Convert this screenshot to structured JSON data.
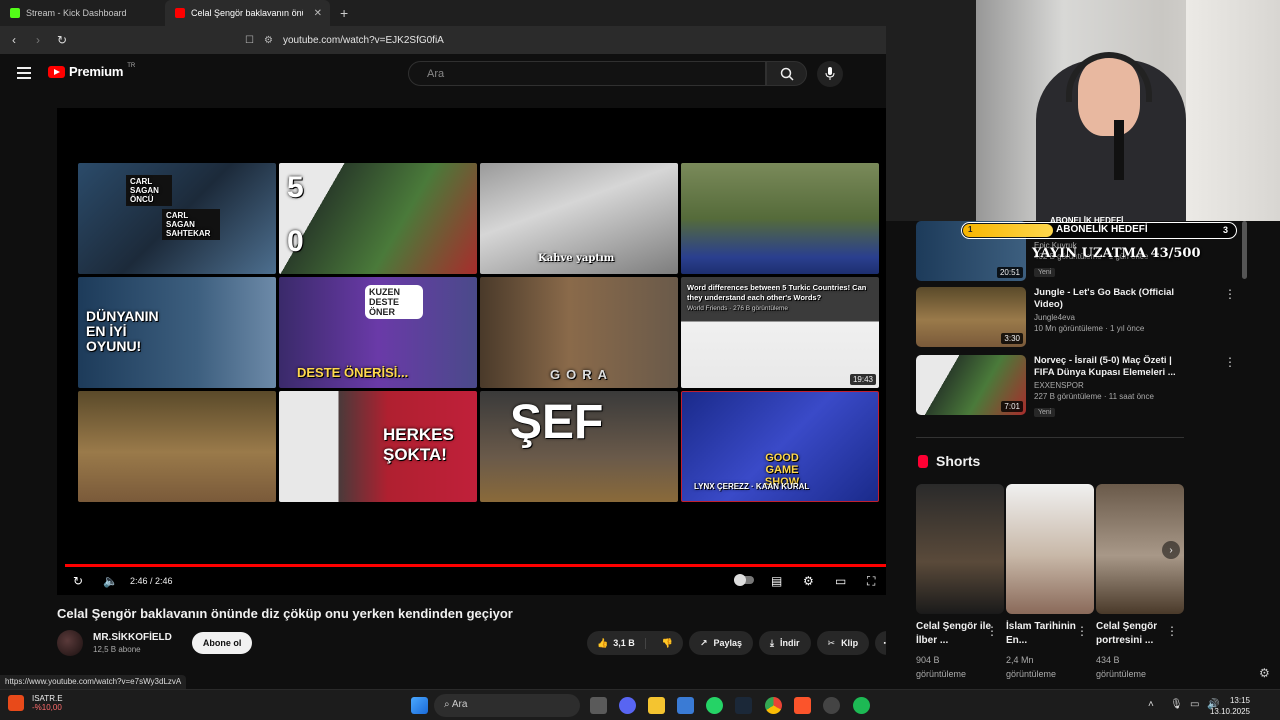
{
  "browser": {
    "tabs": [
      {
        "label": "Stream - Kick Dashboard",
        "active": false
      },
      {
        "label": "Celal Şengör baklavanın önünde",
        "active": true
      }
    ],
    "url": "youtube.com/watch?v=EJK2SfG0fiA",
    "status_url": "https://www.youtube.com/watch?v=e7sWy3dLzvA"
  },
  "youtube": {
    "logo_text": "Premium",
    "logo_sup": "TR",
    "search_placeholder": "Ara"
  },
  "player": {
    "time": "2:46 / 2:46",
    "progress_fraction": 1.0,
    "endscreen": [
      {
        "caption_a": "CARL SAGAN ÖNCÜ",
        "caption_b": "CARL SAGAN SAHTEKAR",
        "duration": ""
      },
      {
        "caption_a": "5",
        "caption_b": "0",
        "duration": ""
      },
      {
        "caption_a": "Kahve yaptım",
        "caption_b": "",
        "duration": ""
      },
      {
        "caption_a": "",
        "caption_b": "",
        "duration": ""
      },
      {
        "caption_a": "DÜNYANIN EN İYİ OYUNU!",
        "caption_b": "",
        "duration": ""
      },
      {
        "caption_a": "KUZEN DESTE ÖNER",
        "caption_b": "DESTE ÖNERİSİ...",
        "duration": ""
      },
      {
        "caption_a": "GORA",
        "caption_b": "",
        "duration": ""
      },
      {
        "caption_a": "Word differences between 5 Turkic Countries! Can they understand each other's Words?",
        "caption_b": "World Friends · 276 B görüntüleme",
        "duration": "19:43"
      },
      {
        "caption_a": "",
        "caption_b": "",
        "duration": ""
      },
      {
        "caption_a": "HERKES ŞOKTA!",
        "caption_b": "",
        "duration": ""
      },
      {
        "caption_a": "ŞEF",
        "caption_b": "",
        "duration": ""
      },
      {
        "caption_a": "GOOD GAME SHOW",
        "caption_b": "LYNX ÇEREZZ · KAAN KURAL",
        "duration": ""
      }
    ]
  },
  "video": {
    "title": "Celal Şengör baklavanın önünde diz çöküp onu yerken kendinden geçiyor",
    "channel": "MR.SİKKOFİELD",
    "subs": "12,5 B abone",
    "subscribe": "Abone ol",
    "likes": "3,1 B",
    "share": "Paylaş",
    "download": "İndir",
    "clip": "Klip"
  },
  "sidebar": {
    "recs": [
      {
        "title": "",
        "meta1": "402 B görüntüleme · 1 gün önce",
        "channel": "Epic Kuyruk",
        "duration": "20:51",
        "badge": "Yeni"
      },
      {
        "title": "Jungle - Let's Go Back (Official Video)",
        "channel": "Jungle4eva",
        "meta1": "10 Mn görüntüleme · 1 yıl önce",
        "duration": "3:30",
        "badge": ""
      },
      {
        "title": "Norveç - İsrail (5-0) Maç Özeti | FIFA Dünya Kupası Elemeleri ...",
        "channel": "EXXENSPOR",
        "meta1": "227 B görüntüleme · 11 saat önce",
        "duration": "7:01",
        "badge": "Yeni"
      }
    ],
    "shorts_heading": "Shorts",
    "shorts": [
      {
        "title": "Celal Şengör ile İlber ...",
        "meta": "904 B görüntüleme"
      },
      {
        "title": "İslam Tarihinin En...",
        "meta": "2,4 Mn görüntüleme"
      },
      {
        "title": "Celal Şengör portresini ...",
        "meta": "434 B görüntüleme"
      }
    ]
  },
  "overlay": {
    "goal_label": "ABONELİK HEDEFİ",
    "goal_start": "1",
    "goal_end": "3",
    "goal_fraction": 0.33,
    "extend_text": "YAYIN UZATMA 43/500"
  },
  "taskbar": {
    "ticker": "ISATR.E",
    "ticker_change": "-%10,00",
    "search": "Ara",
    "time": "13:15",
    "date": "13.10.2025"
  },
  "colors": {
    "accent": "#ff0000",
    "bg": "#0f0f0f",
    "goal": "#f7b500"
  }
}
